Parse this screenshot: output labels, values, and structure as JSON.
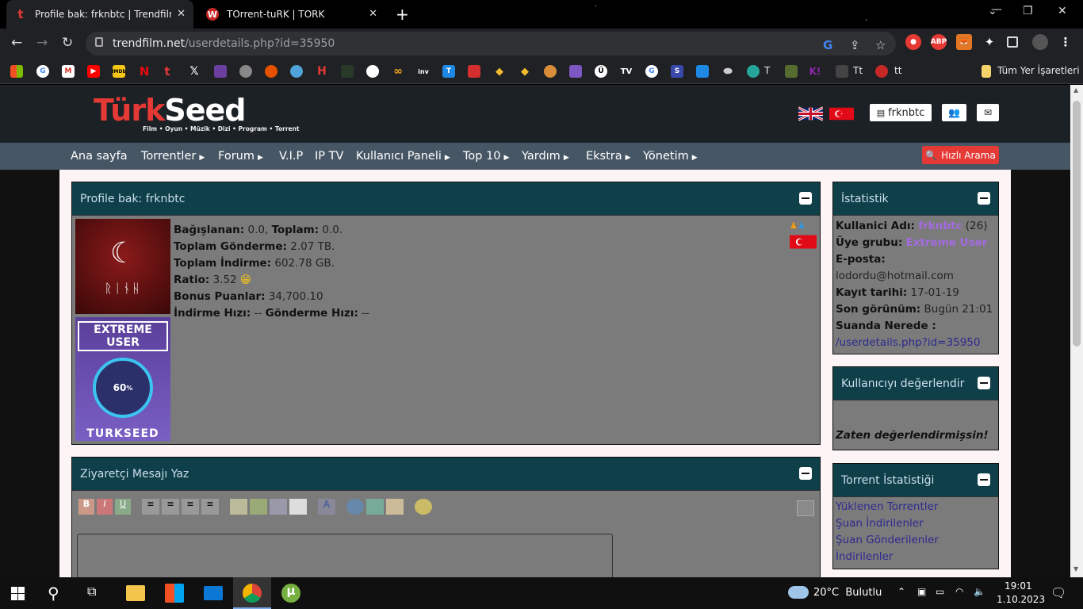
{
  "browser": {
    "tabs": [
      {
        "title": "Profile bak: frknbtc | Trendfilm.net",
        "active": true
      },
      {
        "title": "TOrrent-tuRK | TORK",
        "active": false
      }
    ],
    "address": {
      "host": "trendfilm.net",
      "path": "/userdetails.php?id=35950"
    },
    "bookmarks_folder": "Tüm Yer İşaretleri",
    "bookmark_labels": [
      "T",
      "Tt",
      "tt"
    ],
    "extensions": {
      "abp": "ABP"
    }
  },
  "site": {
    "logo": {
      "part1": "Türk",
      "part2": "Seed",
      "tagline": "Film • Oyun • Müzik • Dizi • Program • Torrent"
    },
    "user_button": "frknbtc",
    "menu": [
      {
        "label": "Ana sayfa",
        "caret": false
      },
      {
        "label": "Torrentler",
        "caret": true
      },
      {
        "label": "Forum",
        "caret": true
      },
      {
        "label": "V.I.P",
        "caret": false
      },
      {
        "label": "IP TV",
        "caret": false
      },
      {
        "label": "Kullanıcı Paneli",
        "caret": true
      },
      {
        "label": "Top 10",
        "caret": true
      },
      {
        "label": "Yardım",
        "caret": true
      },
      {
        "label": "Ekstra",
        "caret": true
      },
      {
        "label": "Yönetim",
        "caret": true
      }
    ],
    "quick_search": "Hızlı Arama"
  },
  "profile_panel": {
    "title": "Profile bak: frknbtc",
    "avatar_text": "ᚱᛁᚾᚺ",
    "badge": {
      "line1": "EXTREME",
      "line2": "USER",
      "percent": "60",
      "brand": "TURKSEED"
    },
    "stats": {
      "donated_label": "Bağışlanan:",
      "donated": "0.0,",
      "total_label": "Toplam:",
      "total": "0.0.",
      "upload_label": "Toplam Gönderme:",
      "upload": "2.07 TB.",
      "download_label": "Toplam İndirme:",
      "download": "602.78 GB.",
      "ratio_label": "Ratio:",
      "ratio": "3.52",
      "bonus_label": "Bonus Puanlar:",
      "bonus": "34,700.10",
      "dl_speed_label": "İndirme Hızı:",
      "dl_speed": "--",
      "ul_speed_label": "Gönderme Hızı:",
      "ul_speed": "--"
    }
  },
  "visitor_panel": {
    "title": "Ziyaretçi Mesajı Yaz"
  },
  "stats_panel": {
    "title": "İstatistik",
    "username_label": "Kullanici Adı:",
    "username": "frknbtc",
    "age": "(26)",
    "group_label": "Üye grubu:",
    "group": "Extreme User",
    "email_label": "E-posta:",
    "email": "lodordu@hotmail.com",
    "reg_label": "Kayıt tarihi:",
    "reg": "17-01-19",
    "seen_label": "Son görünüm:",
    "seen": "Bugün 21:01",
    "where_label": "Suanda Nerede :",
    "where": "/userdetails.php?id=35950"
  },
  "rate_panel": {
    "title": "Kullanıcıyı değerlendir",
    "message": "Zaten değerlendirmişsin!"
  },
  "torrent_panel": {
    "title": "Torrent İstatistiği",
    "links": [
      "Yüklenen Torrentler",
      "Şuan İndirilenler",
      "Şuan Gönderilenler",
      "İndirilenler"
    ]
  },
  "taskbar": {
    "weather": "20°C  Bulutlu",
    "time": "19:01",
    "date": "1.10.2023"
  }
}
